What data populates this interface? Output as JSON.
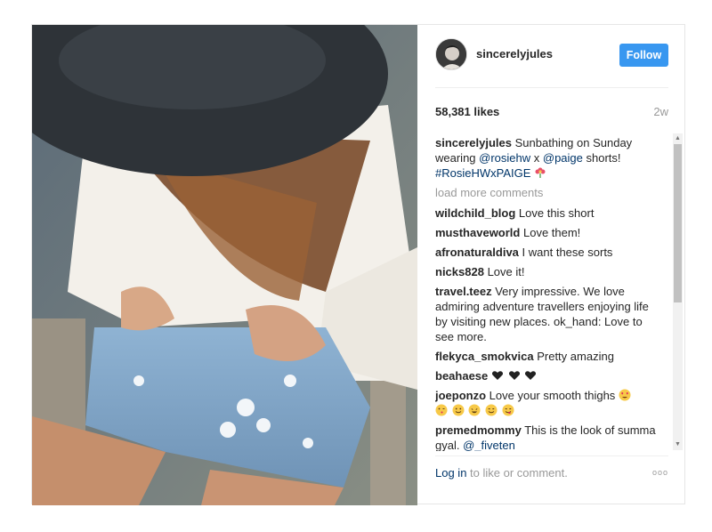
{
  "post": {
    "username": "sincerelyjules",
    "follow_label": "Follow",
    "likes": "58,381 likes",
    "age": "2w",
    "load_more": "load more comments",
    "caption": {
      "user": "sincerelyjules",
      "text_before": "Sunbathing on Sunday wearing ",
      "mention1": "@rosiehw",
      "text_mid": " x ",
      "mention2": "@paige",
      "text_after": " shorts! ",
      "hashtag": "#RosieHWxPAIGE",
      "emoji": "flower-icon"
    },
    "comments": [
      {
        "user": "wildchild_blog",
        "text": "Love this short"
      },
      {
        "user": "musthaveworld",
        "text": "Love them!"
      },
      {
        "user": "afronaturaldiva",
        "text": "I want these sorts"
      },
      {
        "user": "nicks828",
        "text": "Love it!"
      },
      {
        "user": "travel.teez",
        "text": "Very impressive. We love admiring adventure travellers enjoying life by visiting new places. ok_hand: Love to see more."
      },
      {
        "user": "flekyca_smokvica",
        "text": "Pretty amazing"
      },
      {
        "user": "beahaese",
        "text": "",
        "emojis": [
          "black-heart-icon",
          "black-heart-icon",
          "black-heart-icon"
        ]
      },
      {
        "user": "joeponzo",
        "text": "Love your smooth thighs",
        "emojis": [
          "heart-eyes-icon",
          "wink-kiss-icon",
          "smile-icon",
          "grin-icon",
          "blush-icon",
          "yum-icon"
        ]
      },
      {
        "user": "premedmommy",
        "text": "This is the look of summa gyal. ",
        "mention": "@_fiveten"
      }
    ],
    "footer": {
      "login": "Log in",
      "rest": " to like or comment.",
      "more": "ooo"
    },
    "colors": {
      "follow_bg": "#3897f0",
      "link": "#003569",
      "muted": "#999999"
    }
  }
}
